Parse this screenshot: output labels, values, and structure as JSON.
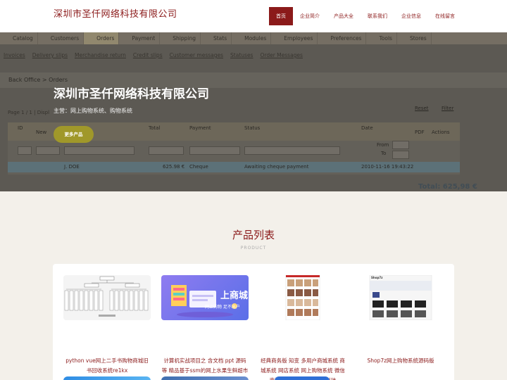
{
  "header": {
    "brand": "深圳市圣仟网络科技有限公司",
    "nav": [
      "首页",
      "企业简介",
      "产品大全",
      "联系我们",
      "企业信息",
      "在线留言"
    ]
  },
  "backoffice": {
    "tabs": [
      "Catalog",
      "Customers",
      "Orders",
      "Payment",
      "Shipping",
      "Stats",
      "Modules",
      "Employees",
      "Preferences",
      "Tools",
      "Stores"
    ],
    "subtabs": [
      "Invoices",
      "Delivery slips",
      "Merchandise return",
      "Credit slips",
      "Customer messages",
      "Statuses",
      "Order Messages"
    ],
    "breadcrumb": "Back Office  >  Orders",
    "pager": "Page 1 / 1 | Displ",
    "columns": [
      "ID",
      "New",
      "Total",
      "Payment",
      "Status",
      "Date",
      "PDF",
      "Actions"
    ],
    "date_from": "From",
    "date_to": "To",
    "reset_button": "Reset",
    "filter_button": "Filter",
    "row": {
      "customer": "J. DOE",
      "total": "625.98 €",
      "payment": "Cheque",
      "status": "Awaiting cheque payment",
      "date": "2010-11-16 19:43:22"
    },
    "total": "Total: 625,98 €"
  },
  "hero": {
    "title": "深圳市圣仟网络科技有限公司",
    "subtitle": "主营：网上购物系统、购物系统",
    "button": "更多产品"
  },
  "products": {
    "title": "产品列表",
    "subtitle": "PRODUCT",
    "items": [
      {
        "caption": "python vue网上二手书购物商城旧书回收系统re1kx"
      },
      {
        "caption": "计算机实战项目之 含文档 ppt 源码等 精品基于ssm的网上水果生鲜超市商城系统",
        "thumb_text": "上商城",
        "thumb_sub": "网上购物  足不出户"
      },
      {
        "caption": "经典商务版 知变 多用户商城系统 商城系统 网店系统 网上购物系统 微信商城系统 电商系统,知变科技"
      },
      {
        "caption": "Shop7z网上购物系统源码版",
        "thumb_text": "Shop7z"
      }
    ]
  },
  "colors": {
    "brand": "#8b1a1a",
    "accent": "#a0982a",
    "background": "#f3f0ea"
  }
}
